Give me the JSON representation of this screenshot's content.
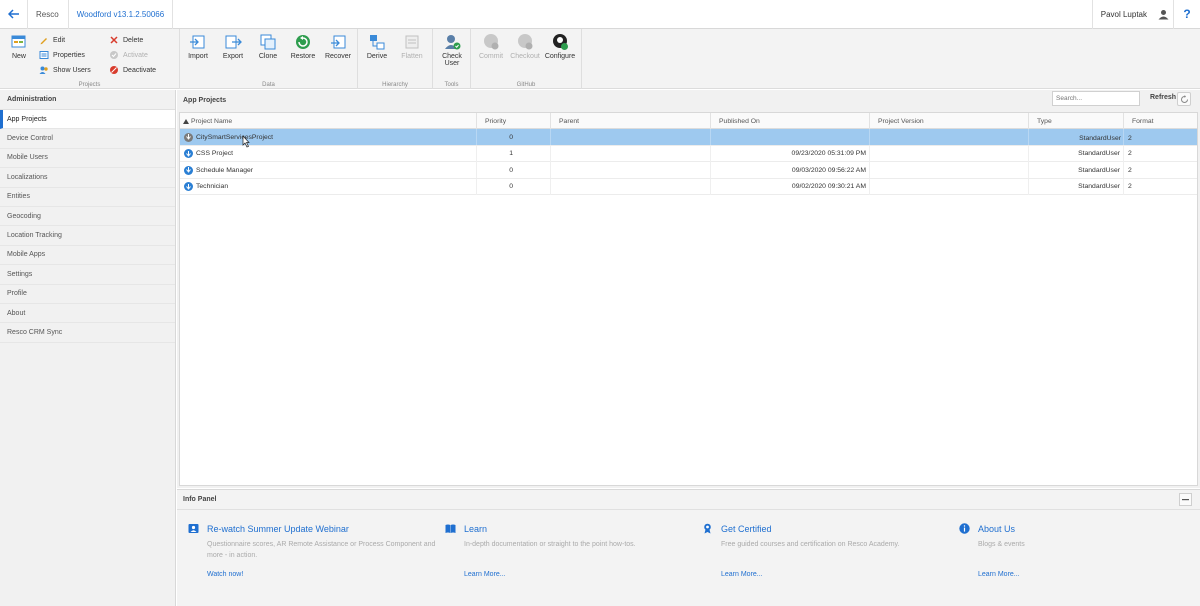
{
  "titlebar": {
    "app_name": "Resco",
    "org_name": "Woodford v13.1.2.50066",
    "user_name": "Pavol Luptak",
    "help_label": "?"
  },
  "ribbon": {
    "projects_group": {
      "label": "Projects",
      "new_label": "New",
      "edit_label": "Edit",
      "properties_label": "Properties",
      "show_users_label": "Show Users",
      "delete_label": "Delete",
      "activate_label": "Activate",
      "deactivate_label": "Deactivate"
    },
    "data_group": {
      "label": "Data",
      "import_label": "Import",
      "export_label": "Export",
      "clone_label": "Clone",
      "restore_label": "Restore",
      "recover_label": "Recover"
    },
    "hierarchy_group": {
      "label": "Hierarchy",
      "derive_label": "Derive",
      "flatten_label": "Flatten"
    },
    "tools_group": {
      "label": "Tools",
      "check_user_label": "Check User"
    },
    "github_group": {
      "label": "GitHub",
      "commit_label": "Commit",
      "checkout_label": "Checkout",
      "configure_label": "Configure"
    }
  },
  "leftnav": {
    "header": "Administration",
    "items": [
      {
        "label": "App Projects",
        "active": true
      },
      {
        "label": "Device Control"
      },
      {
        "label": "Mobile Users"
      },
      {
        "label": "Localizations"
      },
      {
        "label": "Entities"
      },
      {
        "label": "Geocoding"
      },
      {
        "label": "Location Tracking"
      },
      {
        "label": "Mobile Apps"
      },
      {
        "label": "Settings"
      },
      {
        "label": "Profile"
      },
      {
        "label": "About"
      },
      {
        "label": "Resco CRM Sync"
      }
    ]
  },
  "main": {
    "title": "App Projects",
    "search_placeholder": "Search...",
    "refresh_label": "Refresh",
    "columns": [
      "Project Name",
      "Priority",
      "Parent",
      "Published On",
      "Project Version",
      "Type",
      "Format"
    ],
    "rows": [
      {
        "name": "CitySmartServicesProject",
        "priority": "0",
        "parent": "",
        "published": "",
        "version": "",
        "type": "",
        "format": "",
        "selected": true,
        "icon_color": "#7a7a7a"
      },
      {
        "name": "CSS Project",
        "priority": "1",
        "parent": "",
        "published": "09/23/2020 05:31:09 PM",
        "version": "",
        "type": "StandardUser",
        "format": "2",
        "icon_color": "#2a7fd4"
      },
      {
        "name": "Schedule Manager",
        "priority": "0",
        "parent": "",
        "published": "09/03/2020 09:56:22 AM",
        "version": "",
        "type": "StandardUser",
        "format": "2",
        "icon_color": "#2a7fd4"
      },
      {
        "name": "Technician",
        "priority": "0",
        "parent": "",
        "published": "09/02/2020 09:30:21 AM",
        "version": "",
        "type": "StandardUser",
        "format": "2",
        "icon_color": "#2a7fd4"
      }
    ],
    "selected_row_type": "StandardUser",
    "selected_row_format": "2"
  },
  "info_panel": {
    "title": "Info Panel",
    "cards": [
      {
        "title": "Re-watch Summer Update Webinar",
        "desc": "Questionnaire scores, AR Remote Assistance or Process Component and more - in action.",
        "link": "Watch now!",
        "icon": "webinar-icon"
      },
      {
        "title": "Learn",
        "desc": "In-depth documentation or straight to the point how-tos.",
        "link": "Learn More...",
        "icon": "book-icon"
      },
      {
        "title": "Get Certified",
        "desc": "Free guided courses and certification on Resco Academy.",
        "link": "Learn More...",
        "icon": "certificate-icon"
      },
      {
        "title": "About Us",
        "desc": "Blogs & events",
        "link": "Learn More...",
        "icon": "info-icon"
      }
    ]
  },
  "colors": {
    "accent": "#1f6fd0",
    "selection": "#9ec9ef",
    "ribbon_bg": "#f3f3f3",
    "nav_bg": "#f1f1f1"
  }
}
